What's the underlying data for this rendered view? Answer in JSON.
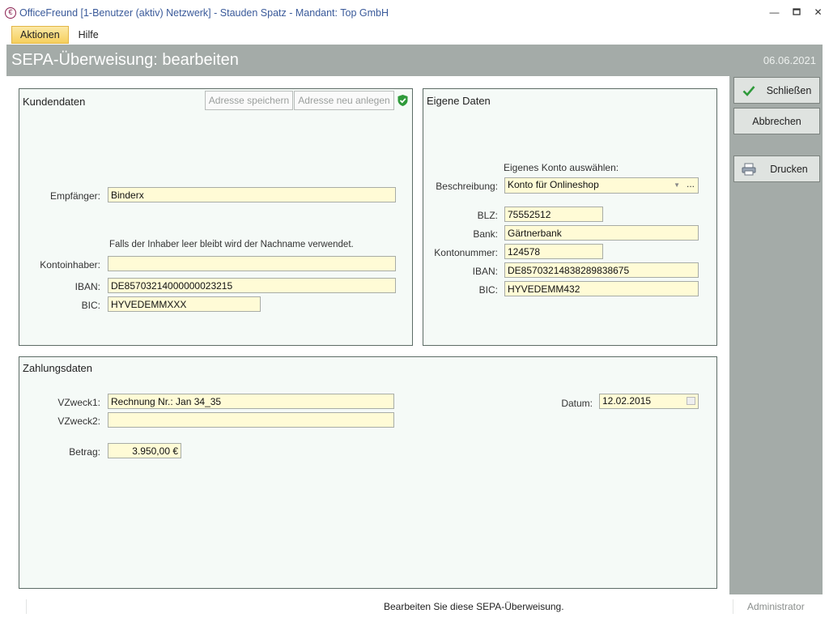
{
  "window": {
    "title": "OfficeFreund [1-Benutzer (aktiv) Netzwerk]  -  Stauden Spatz  -  Mandant: Top GmbH",
    "icon": "officefreund-logo-icon"
  },
  "menu": {
    "items": [
      "Aktionen",
      "Hilfe"
    ]
  },
  "header": {
    "title": "SEPA-Überweisung: bearbeiten",
    "date": "06.06.2021"
  },
  "sidebar": {
    "close_label": "Schließen",
    "cancel_label": "Abbrechen",
    "print_label": "Drucken"
  },
  "kunden": {
    "title": "Kundendaten",
    "save_address_label": "Adresse speichern",
    "new_address_label": "Adresse neu anlegen",
    "empfaenger_label": "Empfänger:",
    "empfaenger_value": "Binderx",
    "hint": "Falls der Inhaber leer bleibt wird der Nachname verwendet.",
    "inhaber_label": "Kontoinhaber:",
    "inhaber_value": "",
    "iban_label": "IBAN:",
    "iban_value": "DE85703214000000023215",
    "bic_label": "BIC:",
    "bic_value": "HYVEDEMMXXX"
  },
  "eigene": {
    "title": "Eigene Daten",
    "select_hint": "Eigenes Konto auswählen:",
    "beschreibung_label": "Beschreibung:",
    "beschreibung_value": "Konto für Onlineshop",
    "blz_label": "BLZ:",
    "blz_value": "75552512",
    "bank_label": "Bank:",
    "bank_value": "Gärtnerbank",
    "kontonummer_label": "Kontonummer:",
    "kontonummer_value": "124578",
    "iban_label": "IBAN:",
    "iban_value": "DE85703214838289838675",
    "bic_label": "BIC:",
    "bic_value": "HYVEDEMM432"
  },
  "zahlung": {
    "title": "Zahlungsdaten",
    "vzweck1_label": "VZweck1:",
    "vzweck1_value": "Rechnung Nr.: Jan 34_35",
    "vzweck2_label": "VZweck2:",
    "vzweck2_value": "",
    "betrag_label": "Betrag:",
    "betrag_value": "3.950,00 €",
    "datum_label": "Datum:",
    "datum_value": "12.02.2015"
  },
  "status": {
    "message": "Bearbeiten Sie diese SEPA-Überweisung.",
    "user": "Administrator"
  },
  "colors": {
    "accent_gray": "#a4aba8",
    "field_bg": "#fffbd6",
    "group_bg": "#f5faf7",
    "title_blue": "#3a5a9a",
    "check_green": "#2e9a3a"
  }
}
